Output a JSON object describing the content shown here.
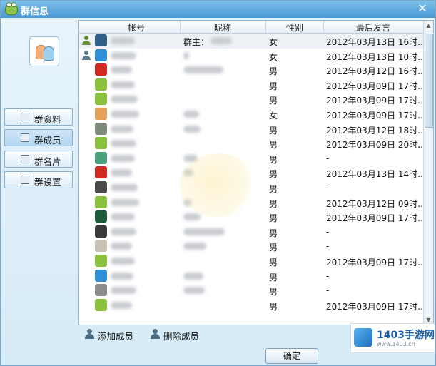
{
  "window": {
    "title": "群信息",
    "close_glyph": "✕"
  },
  "sidebar": {
    "items": [
      {
        "label": "群资料",
        "icon": "info-card-icon",
        "active": false
      },
      {
        "label": "群成员",
        "icon": "members-icon",
        "active": true
      },
      {
        "label": "群名片",
        "icon": "name-card-icon",
        "active": false
      },
      {
        "label": "群设置",
        "icon": "settings-icon",
        "active": false
      }
    ]
  },
  "table": {
    "columns": [
      "帐号",
      "昵称",
      "性别",
      "最后发言"
    ],
    "rows": [
      {
        "role": "owner",
        "avatar_color": "#2f5f86",
        "nickname": "群主：",
        "gender": "女",
        "last": "2012年03月13日 16时..."
      },
      {
        "role": "admin",
        "avatar_color": "#2f8fd8",
        "nickname": "",
        "gender": "女",
        "last": "2012年03月13日 10时..."
      },
      {
        "role": "",
        "avatar_color": "#d22a22",
        "nickname": "",
        "gender": "男",
        "last": "2012年03月12日 16时..."
      },
      {
        "role": "",
        "avatar_color": "#8bbf3e",
        "nickname": "",
        "gender": "男",
        "last": "2012年03月09日 17时..."
      },
      {
        "role": "",
        "avatar_color": "#8bbf3e",
        "nickname": "",
        "gender": "男",
        "last": "2012年03月09日 17时..."
      },
      {
        "role": "",
        "avatar_color": "#e3a15a",
        "nickname": "",
        "gender": "女",
        "last": "2012年03月09日 17时..."
      },
      {
        "role": "",
        "avatar_color": "#7d8a7a",
        "nickname": "",
        "gender": "男",
        "last": "2012年03月12日 18时..."
      },
      {
        "role": "",
        "avatar_color": "#8bbf3e",
        "nickname": "",
        "gender": "男",
        "last": "2012年03月09日 20时..."
      },
      {
        "role": "",
        "avatar_color": "#4ca07c",
        "nickname": "",
        "gender": "男",
        "last": "-"
      },
      {
        "role": "",
        "avatar_color": "#d22a22",
        "nickname": "",
        "gender": "男",
        "last": "2012年03月13日 14时..."
      },
      {
        "role": "",
        "avatar_color": "#4a4a4a",
        "nickname": "",
        "gender": "男",
        "last": "-"
      },
      {
        "role": "",
        "avatar_color": "#8bbf3e",
        "nickname": "",
        "gender": "男",
        "last": "2012年03月12日 09时..."
      },
      {
        "role": "",
        "avatar_color": "#1c5a3a",
        "nickname": "",
        "gender": "男",
        "last": "2012年03月09日 17时..."
      },
      {
        "role": "",
        "avatar_color": "#3a3a3a",
        "nickname": "",
        "gender": "男",
        "last": "-"
      },
      {
        "role": "",
        "avatar_color": "#c9c2b4",
        "nickname": "",
        "gender": "男",
        "last": "-"
      },
      {
        "role": "",
        "avatar_color": "#8bbf3e",
        "nickname": "",
        "gender": "男",
        "last": "2012年03月09日 17时..."
      },
      {
        "role": "",
        "avatar_color": "#2f8fd8",
        "nickname": "",
        "gender": "男",
        "last": "-"
      },
      {
        "role": "",
        "avatar_color": "#8c8c8c",
        "nickname": "",
        "gender": "男",
        "last": "-"
      },
      {
        "role": "",
        "avatar_color": "#8bbf3e",
        "nickname": "",
        "gender": "男",
        "last": "2012年03月09日 17时..."
      }
    ]
  },
  "actions": {
    "add": "添加成员",
    "remove": "删除成员"
  },
  "footer": {
    "ok": "确定"
  },
  "watermark": {
    "site": "1403手游网",
    "url": "www.1403.cn"
  }
}
